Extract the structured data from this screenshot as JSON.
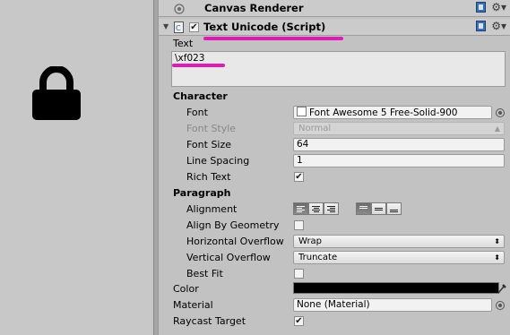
{
  "scene": {
    "lock_icon": "lock-icon"
  },
  "canvas_renderer": {
    "title": "Canvas Renderer"
  },
  "text_unicode": {
    "title": "Text Unicode (Script)",
    "enabled": true
  },
  "text": {
    "label": "Text",
    "value": "\\xf023"
  },
  "character": {
    "header": "Character",
    "font_label": "Font",
    "font_value": "Font Awesome 5 Free-Solid-900",
    "font_style_label": "Font Style",
    "font_style_value": "Normal",
    "font_size_label": "Font Size",
    "font_size_value": "64",
    "line_spacing_label": "Line Spacing",
    "line_spacing_value": "1",
    "rich_text_label": "Rich Text",
    "rich_text_checked": true
  },
  "paragraph": {
    "header": "Paragraph",
    "alignment_label": "Alignment",
    "align_by_geometry_label": "Align By Geometry",
    "horizontal_overflow_label": "Horizontal Overflow",
    "horizontal_overflow_value": "Wrap",
    "vertical_overflow_label": "Vertical Overflow",
    "vertical_overflow_value": "Truncate",
    "best_fit_label": "Best Fit"
  },
  "color_label": "Color",
  "color_value": "#000000",
  "material_label": "Material",
  "material_value": "None (Material)",
  "raycast_label": "Raycast Target",
  "raycast_checked": true,
  "accent": "#e01ab4"
}
